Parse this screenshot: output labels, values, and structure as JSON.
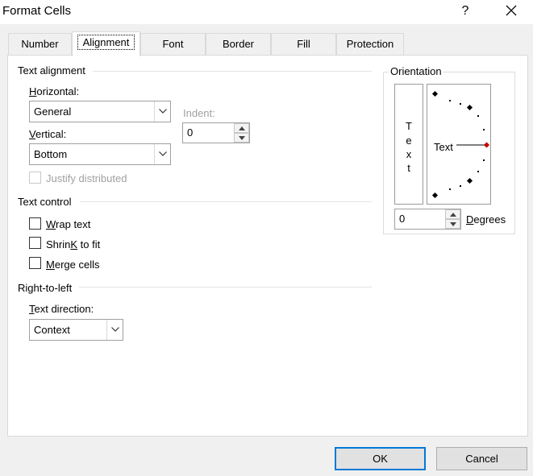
{
  "window": {
    "title": "Format Cells",
    "help_glyph": "?"
  },
  "tabs": [
    {
      "label": "Number",
      "active": false
    },
    {
      "label": "Alignment",
      "active": true
    },
    {
      "label": "Font",
      "active": false
    },
    {
      "label": "Border",
      "active": false
    },
    {
      "label": "Fill",
      "active": false
    },
    {
      "label": "Protection",
      "active": false
    }
  ],
  "text_alignment": {
    "heading": "Text alignment",
    "horizontal_label_key": "H",
    "horizontal_label_rest": "orizontal:",
    "horizontal_value": "General",
    "vertical_label_key": "V",
    "vertical_label_rest": "ertical:",
    "vertical_value": "Bottom",
    "indent_label": "Indent:",
    "indent_value": "0",
    "justify_label": "Justify distributed",
    "justify_checked": false
  },
  "text_control": {
    "heading": "Text control",
    "wrap_key": "W",
    "wrap_rest": "rap text",
    "wrap_checked": false,
    "shrink_key": "K",
    "shrink_pre": "Shrin",
    "shrink_rest": " to fit",
    "shrink_checked": false,
    "merge_key": "M",
    "merge_rest": "erge cells",
    "merge_checked": false
  },
  "right_to_left": {
    "heading": "Right-to-left",
    "direction_key": "T",
    "direction_rest": "ext direction:",
    "direction_value": "Context"
  },
  "orientation": {
    "heading": "Orientation",
    "vertical_chars": [
      "T",
      "e",
      "x",
      "t"
    ],
    "dial_text": "Text",
    "degrees_value": "0",
    "degrees_key": "D",
    "degrees_rest": "egrees",
    "angle_degrees": 0
  },
  "buttons": {
    "ok": "OK",
    "cancel": "Cancel"
  },
  "colors": {
    "accent": "#0078d7",
    "dial_marker": "#c00000"
  }
}
